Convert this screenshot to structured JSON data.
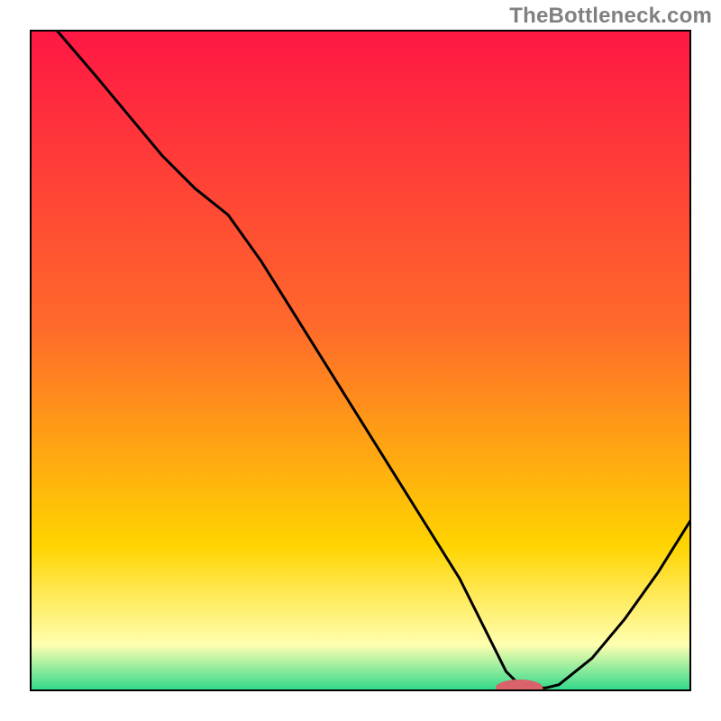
{
  "watermark": "TheBottleneck.com",
  "colors": {
    "frame": "#000000",
    "curve": "#000000",
    "marker_fill": "#d9626b",
    "marker_stroke": "#d9626b",
    "grad_top": "#ff1744",
    "grad_mid1": "#ff6a2a",
    "grad_mid2": "#ffd400",
    "grad_band": "#ffffb0",
    "grad_bottom": "#2bd88a"
  },
  "chart_data": {
    "type": "line",
    "title": "",
    "xlabel": "",
    "ylabel": "",
    "xlim": [
      0,
      100
    ],
    "ylim": [
      0,
      100
    ],
    "axes_visible": false,
    "gradient_background": true,
    "series": [
      {
        "name": "bottleneck-curve",
        "x": [
          4,
          10,
          15,
          20,
          25,
          30,
          35,
          40,
          45,
          50,
          55,
          60,
          65,
          70,
          72,
          74,
          76,
          78,
          80,
          85,
          90,
          95,
          100
        ],
        "y": [
          100,
          93,
          87,
          81,
          76,
          72,
          65,
          57,
          49,
          41,
          33,
          25,
          17,
          7,
          3,
          1,
          0.5,
          0.5,
          1,
          5,
          11,
          18,
          26
        ]
      }
    ],
    "marker": {
      "x_center": 74,
      "y": 0.5,
      "rx_frac": 0.035,
      "ry_frac": 0.012
    }
  }
}
